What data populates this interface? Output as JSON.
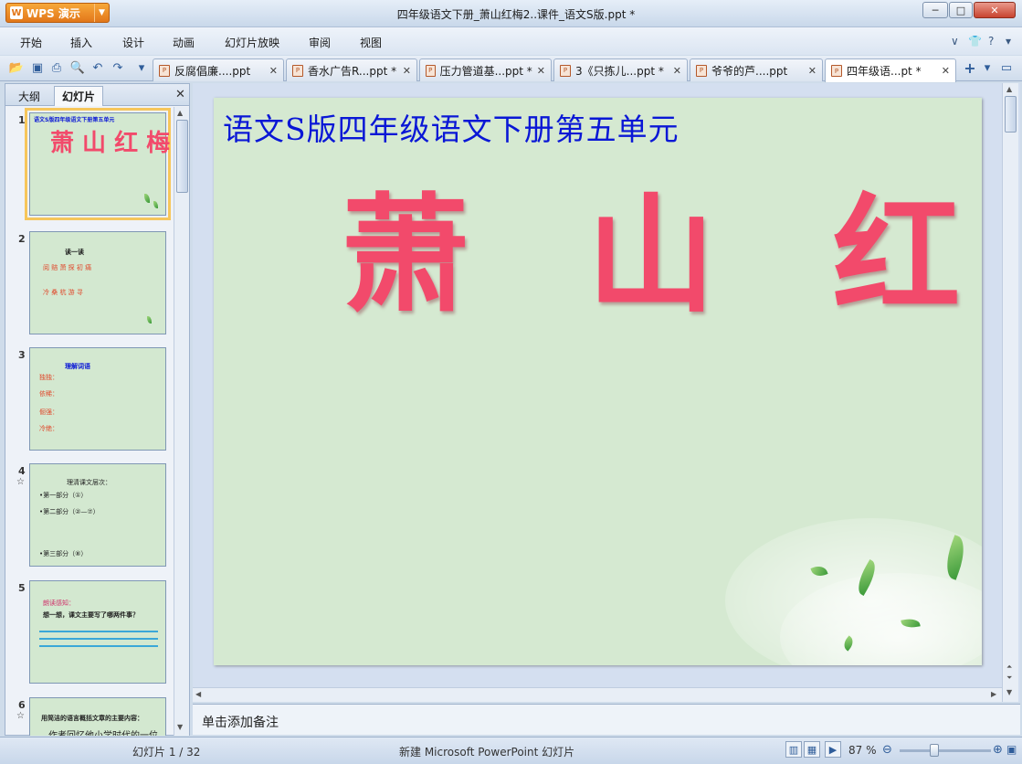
{
  "app": {
    "name": "WPS 演示"
  },
  "window": {
    "title": "四年级语文下册_萧山红梅2..课件_语文S版.ppt *",
    "min": "─",
    "max": "□",
    "close": "✕"
  },
  "menu": [
    "开始",
    "插入",
    "设计",
    "动画",
    "幻灯片放映",
    "审阅",
    "视图"
  ],
  "doc_tabs": [
    {
      "label": "反腐倡廉....ppt"
    },
    {
      "label": "香水广告R...ppt *"
    },
    {
      "label": "压力管道基...ppt *"
    },
    {
      "label": "3《只拣儿...ppt *"
    },
    {
      "label": "爷爷的芦....ppt"
    },
    {
      "label": "四年级语...pt *"
    }
  ],
  "left_panel": {
    "tabs": [
      "大纲",
      "幻灯片"
    ],
    "active_tab": "幻灯片"
  },
  "thumbnails": [
    {
      "num": "1",
      "header": "语文S版四年级语文下册第五单元",
      "title": "萧 山 红 梅"
    },
    {
      "num": "2",
      "lines": [
        "读一读",
        "阅 赔 萧 探 初 痛",
        "冷 桑 杭 游 寻"
      ]
    },
    {
      "num": "3",
      "lines": [
        "理解词语",
        "独独：",
        "依稀：",
        "倔强：",
        "冷绝："
      ]
    },
    {
      "num": "4",
      "star": "☆",
      "lines": [
        "理清课文层次：",
        "•第一部分（①）",
        "•第二部分（②—⑦）",
        "•第三部分（⑧）"
      ]
    },
    {
      "num": "5",
      "lines": [
        "朗读感知：",
        "想一想，课文主要写了哪两件事？"
      ]
    },
    {
      "num": "6",
      "star": "☆",
      "lines": [
        "用简洁的语言概括文章的主要内容：",
        "作者回忆他小学时代的一位"
      ]
    }
  ],
  "slide": {
    "subtitle": "语文S版四年级语文下册第五单元",
    "title": "萧 山 红 梅"
  },
  "notes": {
    "placeholder": "单击添加备注"
  },
  "status": {
    "slide_counter": "幻灯片 1 / 32",
    "template": "新建 Microsoft PowerPoint 幻灯片",
    "zoom": "87 %"
  }
}
